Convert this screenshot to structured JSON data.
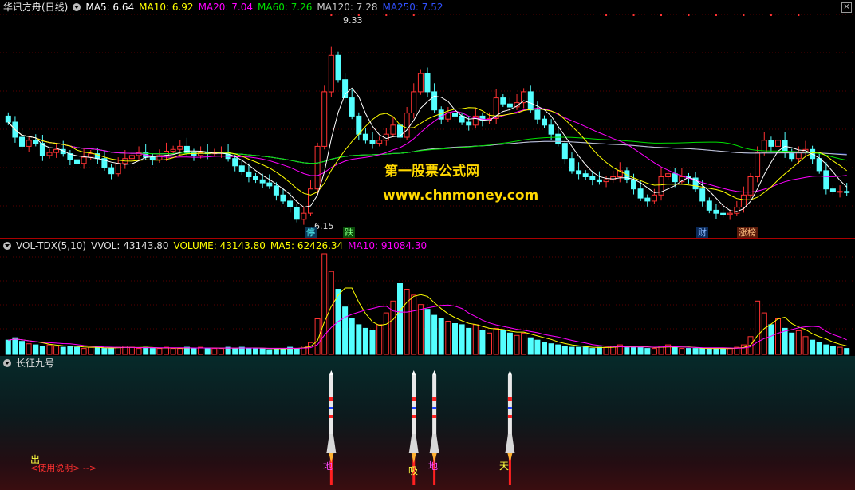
{
  "price_header": {
    "title": "华讯方舟(日线)",
    "ma5": "MA5: 6.64",
    "ma10": "MA10: 6.92",
    "ma20": "MA20: 7.04",
    "ma60": "MA60: 7.26",
    "ma120": "MA120: 7.28",
    "ma250": "MA250: 7.52"
  },
  "price_labels": {
    "high": "9.33",
    "low": "6.15",
    "tag_stop": "停",
    "tag_fall": "跌",
    "tag_fin": "财",
    "tag_rank": "涨榜"
  },
  "watermark": {
    "line1": "第一股票公式网",
    "line2": "www.chnmoney.com"
  },
  "vol_header": {
    "name": "VOL-TDX(5,10)",
    "vvol": "VVOL: 43143.80",
    "volume": "VOLUME: 43143.80",
    "ma5": "MA5: 62426.34",
    "ma10": "MA10: 91084.30"
  },
  "ind_header": {
    "name": "长征九号"
  },
  "ind_labels": {
    "sig1": "地",
    "sig2": "吸",
    "sig3": "地",
    "sig4": "天",
    "out": "出",
    "usage": "<使用说明> -->"
  },
  "colors": {
    "up": "#ff3232",
    "down": "#54ffff",
    "ma5": "#ffffff",
    "ma10": "#ffff00",
    "ma20": "#ff00ff",
    "ma60": "#00e000",
    "ma120": "#c8c8c8",
    "ma250": "#3050ff"
  },
  "chart_data": {
    "type": "candlestick",
    "price_high_label": 9.33,
    "price_low_label": 6.15,
    "ma_last": {
      "MA5": 6.64,
      "MA10": 6.92,
      "MA20": 7.04,
      "MA60": 7.26,
      "MA120": 7.28,
      "MA250": 7.52
    },
    "volume_last": {
      "VOLUME": 43143.8,
      "MA5": 62426.34,
      "MA10": 91084.3
    },
    "closes": [
      7.8,
      7.55,
      7.4,
      7.5,
      7.45,
      7.25,
      7.3,
      7.35,
      7.28,
      7.18,
      7.12,
      7.22,
      7.28,
      7.2,
      7.05,
      6.95,
      7.12,
      7.2,
      7.25,
      7.3,
      7.22,
      7.18,
      7.25,
      7.32,
      7.35,
      7.4,
      7.3,
      7.25,
      7.3,
      7.28,
      7.3,
      7.3,
      7.2,
      7.08,
      6.98,
      6.9,
      6.85,
      6.8,
      6.75,
      6.6,
      6.5,
      6.4,
      6.2,
      6.3,
      6.7,
      7.4,
      8.3,
      8.9,
      8.5,
      8.2,
      7.9,
      7.6,
      7.5,
      7.45,
      7.5,
      7.6,
      7.75,
      7.55,
      7.95,
      8.3,
      8.6,
      8.3,
      8.0,
      7.85,
      7.95,
      7.9,
      7.8,
      7.75,
      7.9,
      7.82,
      7.86,
      8.2,
      8.1,
      8.05,
      8.12,
      8.3,
      8.0,
      7.85,
      7.75,
      7.6,
      7.45,
      7.2,
      7.0,
      6.95,
      6.9,
      6.85,
      6.82,
      6.85,
      6.9,
      7.0,
      6.85,
      6.7,
      6.55,
      6.5,
      6.6,
      6.9,
      6.95,
      6.82,
      6.9,
      6.88,
      6.7,
      6.5,
      6.35,
      6.3,
      6.28,
      6.3,
      6.4,
      6.6,
      6.9,
      7.3,
      7.5,
      7.4,
      7.5,
      7.3,
      7.2,
      7.3,
      7.35,
      7.2,
      7.0,
      6.7,
      6.65,
      6.66,
      6.64
    ],
    "volumes": [
      12,
      14,
      11,
      9,
      8,
      7,
      8,
      7,
      6,
      7,
      6,
      5,
      6,
      6,
      5,
      5,
      6,
      7,
      6,
      5,
      6,
      5,
      5,
      6,
      5,
      5,
      6,
      5,
      6,
      5,
      5,
      5,
      6,
      5,
      6,
      5,
      5,
      5,
      4,
      5,
      5,
      6,
      5,
      7,
      10,
      30,
      85,
      70,
      55,
      40,
      30,
      25,
      22,
      20,
      25,
      35,
      45,
      60,
      55,
      50,
      42,
      38,
      33,
      30,
      28,
      26,
      25,
      22,
      25,
      20,
      18,
      22,
      20,
      18,
      16,
      18,
      14,
      12,
      10,
      9,
      8,
      7,
      6,
      6,
      6,
      5,
      6,
      6,
      7,
      8,
      6,
      7,
      6,
      5,
      5,
      7,
      8,
      6,
      5,
      5,
      5,
      5,
      5,
      5,
      5,
      5,
      6,
      8,
      15,
      45,
      35,
      25,
      30,
      22,
      18,
      20,
      15,
      12,
      10,
      8,
      7,
      6,
      5
    ],
    "vol_max": 120000,
    "signals": [
      {
        "index": 47,
        "label": "地"
      },
      {
        "index": 59,
        "label": "吸"
      },
      {
        "index": 62,
        "label": "地"
      },
      {
        "index": 73,
        "label": "天"
      }
    ]
  }
}
